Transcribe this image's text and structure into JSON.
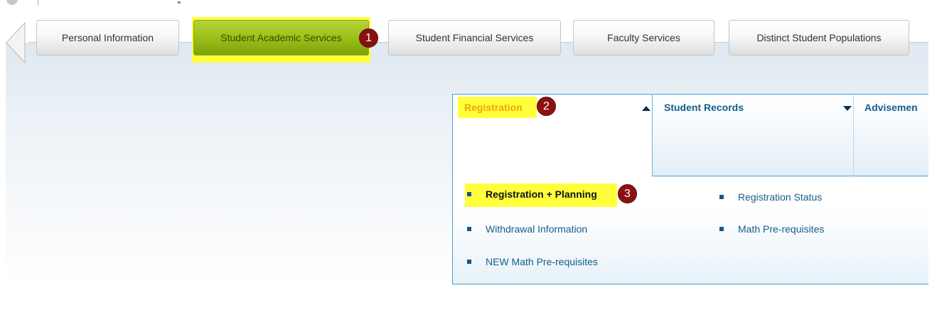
{
  "tabs": [
    {
      "label": "Personal Information",
      "active": false
    },
    {
      "label": "Student Academic Services",
      "active": true
    },
    {
      "label": "Student Financial Services",
      "active": false
    },
    {
      "label": "Faculty Services",
      "active": false
    },
    {
      "label": "Distinct Student Populations",
      "active": false
    }
  ],
  "callouts": [
    "1",
    "2",
    "3"
  ],
  "menu": {
    "headers": [
      {
        "label": "Registration",
        "expanded": true,
        "icon": "caret-up-icon"
      },
      {
        "label": "Student Records",
        "expanded": false,
        "icon": "caret-down-icon"
      },
      {
        "label": "Advisemen"
      }
    ],
    "items": [
      {
        "label": "Registration + Planning",
        "highlighted": true
      },
      {
        "label": "Registration Status"
      },
      {
        "label": "Withdrawal Information"
      },
      {
        "label": "Math Pre-requisites"
      },
      {
        "label": "NEW Math Pre-requisites"
      }
    ]
  },
  "colors": {
    "highlight": "#ffff3c",
    "active_tab": "#9fc31b",
    "badge": "#8b1111",
    "link": "#145e8a",
    "menu_border": "#4d9dd2",
    "expanded_header": "#f0a600"
  }
}
